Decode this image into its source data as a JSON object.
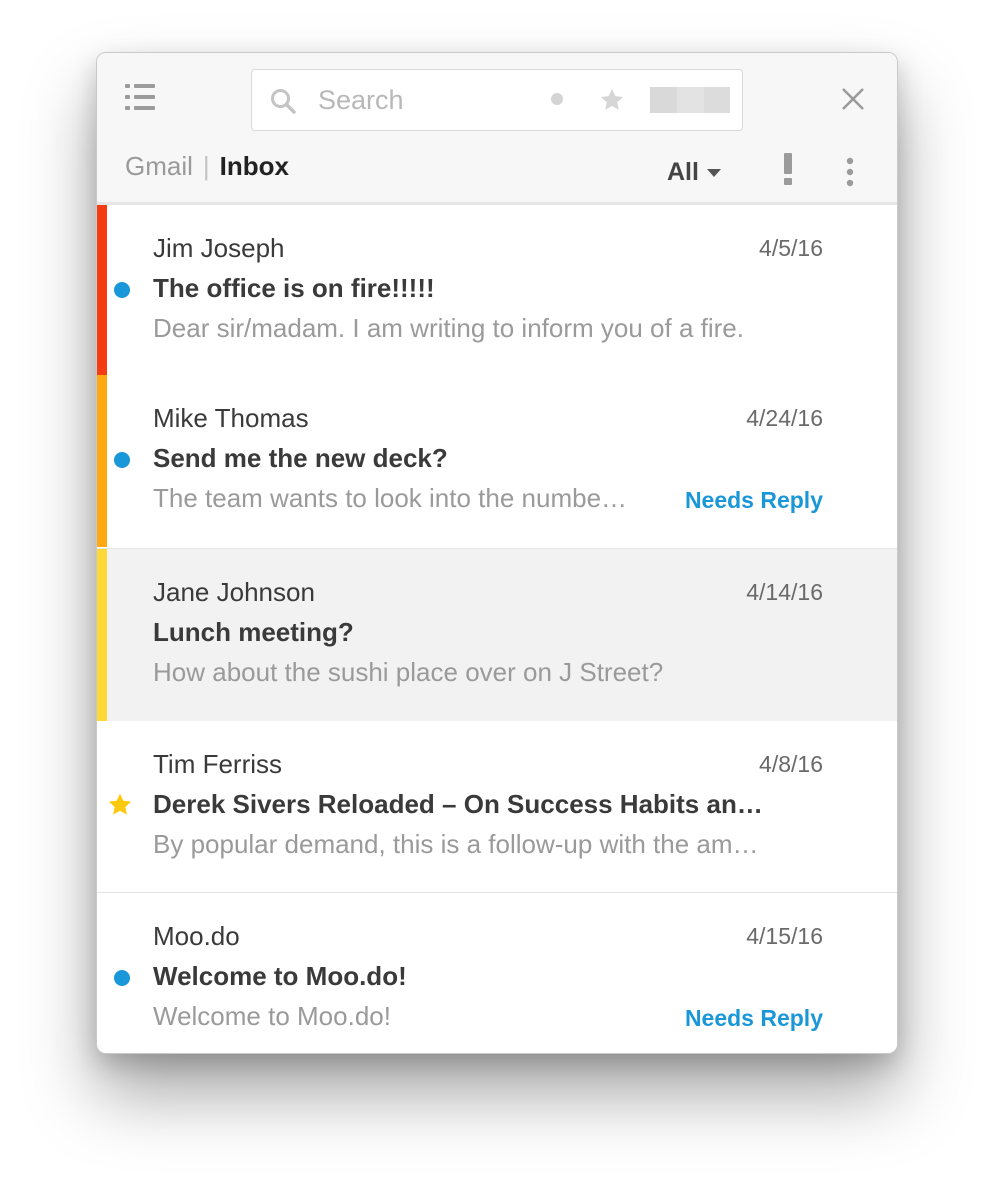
{
  "header": {
    "search_placeholder": "Search",
    "account": "Gmail",
    "separator": "|",
    "folder": "Inbox",
    "filter_label": "All"
  },
  "icons": {
    "menu": "menu-list-icon",
    "search": "search-icon",
    "close": "close-icon",
    "important": "exclamation-icon",
    "more": "vertical-dots-icon",
    "star": "star-icon"
  },
  "colors": {
    "accent_blue": "#1a97d8",
    "priority_red": "#f53b12",
    "priority_orange": "#ffa812",
    "priority_yellow": "#fcd936",
    "star_yellow": "#fdc90e"
  },
  "emails": [
    {
      "sender": "Jim Joseph",
      "date": "4/5/16",
      "subject": "The office is on fire!!!!!",
      "snippet": "Dear sir/madam. I am writing to inform you of a fire.",
      "tag": "",
      "unread": true,
      "starred": false,
      "priority_color": "#f53b12"
    },
    {
      "sender": "Mike Thomas",
      "date": "4/24/16",
      "subject": "Send me the new deck?",
      "snippet": "The team wants to look into the numbe…",
      "tag": "Needs Reply",
      "unread": true,
      "starred": false,
      "priority_color": "#ffa812"
    },
    {
      "sender": "Jane Johnson",
      "date": "4/14/16",
      "subject": "Lunch meeting?",
      "snippet": "How about the sushi place over on J Street?",
      "tag": "",
      "unread": false,
      "starred": false,
      "selected": true,
      "priority_color": "#fcd936"
    },
    {
      "sender": "Tim Ferriss",
      "date": "4/8/16",
      "subject": "Derek Sivers Reloaded – On Success Habits an…",
      "snippet": "By popular demand, this is a follow-up with the am…",
      "tag": "",
      "unread": false,
      "starred": true,
      "priority_color": ""
    },
    {
      "sender": "Moo.do",
      "date": "4/15/16",
      "subject": "Welcome to Moo.do!",
      "snippet": "Welcome to Moo.do!",
      "tag": "Needs Reply",
      "unread": true,
      "starred": false,
      "priority_color": ""
    }
  ]
}
